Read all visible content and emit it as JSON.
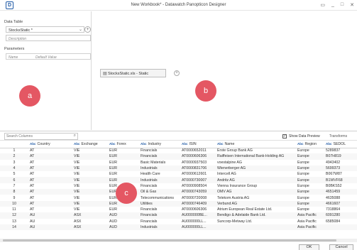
{
  "window": {
    "title": "New Workbook* - Datawatch Panopticon Designer",
    "logo_letter": "D",
    "buttons": [
      "▭",
      "_",
      "□",
      "✕"
    ]
  },
  "left_panel": {
    "data_table_label": "Data Table",
    "data_table_value": "StocksStatic *",
    "description_placeholder": "Description",
    "parameters_label": "Parameters",
    "param_columns": [
      "Name",
      "Default Value"
    ]
  },
  "canvas": {
    "node_label": "StocksStatic.xls - Static"
  },
  "badges": {
    "a": "a",
    "b": "b",
    "c": "c"
  },
  "toolbar": {
    "search_placeholder": "Search Columns",
    "show_preview_label": "Show Data Preview",
    "show_preview_checked": true,
    "transforms_label": "Transforms"
  },
  "grid": {
    "columns": [
      "Country",
      "Exchange",
      "Forex",
      "Industry",
      "ISIN",
      "Name",
      "Region",
      "SEDOL"
    ],
    "rows": [
      [
        "1",
        "AT",
        "VIE",
        "EUR",
        "Financials",
        "AT0000652011",
        "Erste Group Bank AG",
        "Europe",
        "5289837"
      ],
      [
        "2",
        "AT",
        "VIE",
        "EUR",
        "Financials",
        "AT0000606306",
        "Raiffeisen International Bank-Holding AG",
        "Europe",
        "B07H819"
      ],
      [
        "3",
        "AT",
        "VIE",
        "EUR",
        "Basic Materials",
        "AT0000937503",
        "voestalpine AG",
        "Europe",
        "4943402"
      ],
      [
        "4",
        "AT",
        "VIE",
        "EUR",
        "Industrials",
        "AT0000831706",
        "Wienerberger AG",
        "Europe",
        "5699373"
      ],
      [
        "5",
        "AT",
        "VIE",
        "EUR",
        "Health Care",
        "AT0000612601",
        "Intercell AG",
        "Europe",
        "B067W87"
      ],
      [
        "6",
        "AT",
        "VIE",
        "EUR",
        "Industrials",
        "AT0000730007",
        "Andritz AG",
        "Europe",
        "B1WVF68"
      ],
      [
        "7",
        "AT",
        "VIE",
        "EUR",
        "Financials",
        "AT0000908504",
        "Vienna Insurance Group",
        "Europe",
        "B0BKS52"
      ],
      [
        "8",
        "AT",
        "VIE",
        "EUR",
        "Oil & Gas",
        "AT0000743059",
        "OMV AG",
        "Europe",
        "4651459"
      ],
      [
        "9",
        "AT",
        "VIE",
        "EUR",
        "Telecommunications",
        "AT0000720008",
        "Telekom Austria AG",
        "Europe",
        "4635088"
      ],
      [
        "10",
        "AT",
        "VIE",
        "EUR",
        "Utilities",
        "AT0000746409",
        "Verbund AG",
        "Europe",
        "4661607"
      ],
      [
        "11",
        "AT",
        "VIE",
        "EUR",
        "Financials",
        "AT0000606306",
        "Atrium European Real Estate Ltd.",
        "Europe",
        "7318864"
      ],
      [
        "12",
        "AU",
        "ASX",
        "AUD",
        "Financials",
        "AU000000BE...",
        "Bendigo & Adelaide Bank Ltd.",
        "Asia Pacific",
        "6091280"
      ],
      [
        "13",
        "AU",
        "ASX",
        "AUD",
        "Financials",
        "AU000000LL...",
        "Suncorp-Metway Ltd.",
        "Asia Pacific",
        "6585084"
      ],
      [
        "14",
        "AU",
        "ASX",
        "AUD",
        "Industrials",
        "AU000000LL...",
        "",
        "Asia Pacific",
        ""
      ]
    ]
  },
  "footer": {
    "ok_label": "OK",
    "cancel_label": "Cancel"
  }
}
